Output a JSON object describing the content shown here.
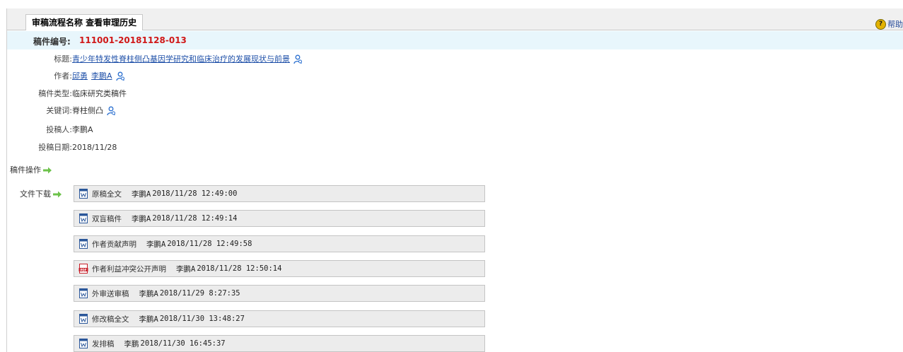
{
  "page_tab": "审稿流程名称 查看审理历史",
  "help_label": "帮助",
  "manuscript": {
    "id_label": "稿件编号:",
    "id_value": "111001-20181128-013",
    "title_label": "标题:",
    "title_value": "青少年特发性脊柱侧凸基因学研究和临床治疗的发展现状与前景",
    "authors_label": "作者:",
    "authors": [
      "邱勇",
      "李鹏A"
    ],
    "type_label": "稿件类型:",
    "type_value": "临床研究类稿件",
    "keywords_label": "关键词:",
    "keywords_value": "脊柱侧凸",
    "submitter_label": "投稿人:",
    "submitter_value": "李鹏A",
    "date_label": "投稿日期:",
    "date_value": "2018/11/28"
  },
  "actions_label": "稿件操作",
  "downloads_label": "文件下载",
  "files": [
    {
      "name": "原稿全文",
      "person": "李鹏A",
      "time": "2018/11/28 12:49:00",
      "icon": "word-doc-icon"
    },
    {
      "name": "双盲稿件",
      "person": "李鹏A",
      "time": "2018/11/28 12:49:14",
      "icon": "word-doc-icon"
    },
    {
      "name": "作者贡献声明",
      "person": "李鹏A",
      "time": "2018/11/28 12:49:58",
      "icon": "word-doc-icon"
    },
    {
      "name": "作者利益冲突公开声明",
      "person": "李鹏A",
      "time": "2018/11/28 12:50:14",
      "icon": "pdf-icon"
    },
    {
      "name": "外审送审稿",
      "person": "李鹏A",
      "time": "2018/11/29 8:27:35",
      "icon": "word-doc-icon"
    },
    {
      "name": "修改稿全文",
      "person": "李鹏A",
      "time": "2018/11/30 13:48:27",
      "icon": "word-doc-icon"
    },
    {
      "name": "发排稿",
      "person": "李鹏",
      "time": "2018/11/30 16:45:37",
      "icon": "word-doc-icon"
    }
  ]
}
